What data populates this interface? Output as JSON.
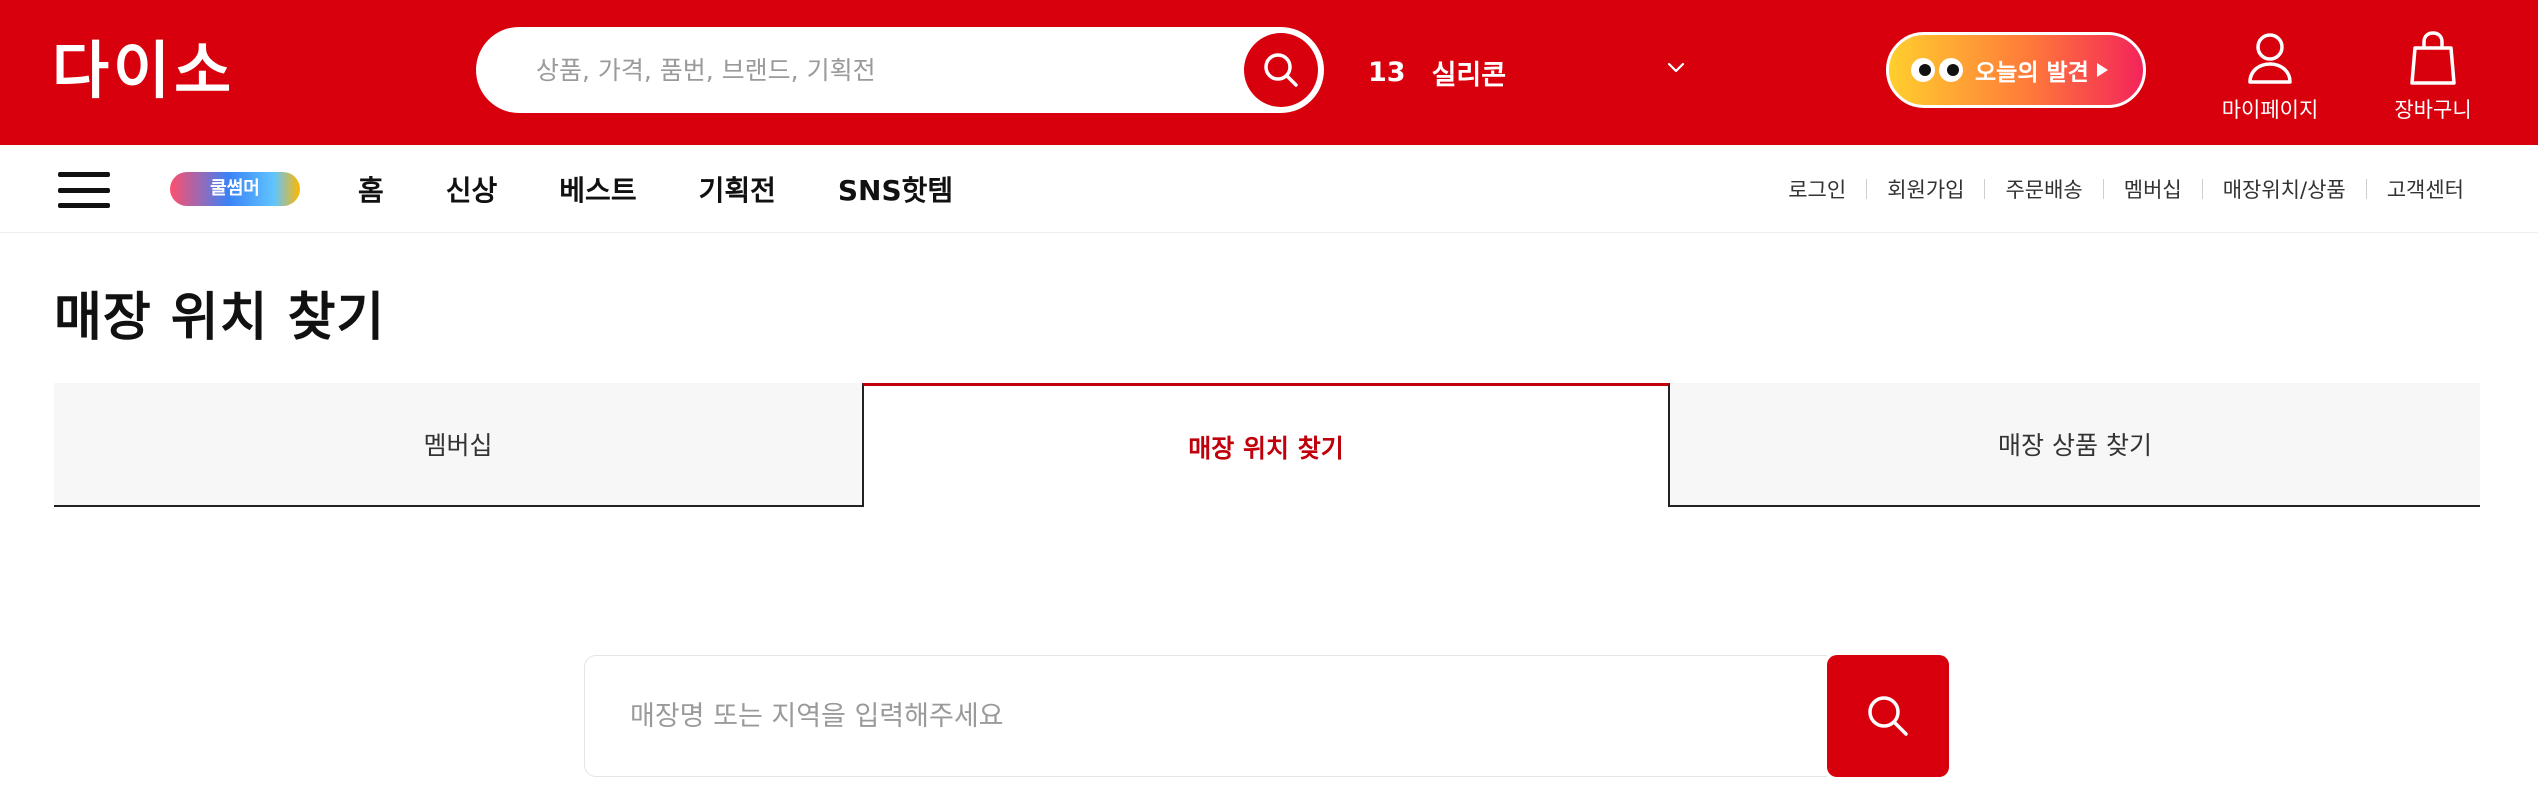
{
  "header": {
    "logo_text": "다이소",
    "search_placeholder": "상품, 가격, 품번, 브랜드, 기획전",
    "ranking": {
      "number": "13",
      "keyword": "실리콘"
    },
    "discover_label": "오늘의 발견",
    "mypage_label": "마이페이지",
    "cart_label": "장바구니"
  },
  "nav": {
    "promo_label": "쿨썸머",
    "menu": [
      "홈",
      "신상",
      "베스트",
      "기획전",
      "SNS핫템"
    ],
    "util_links": [
      "로그인",
      "회원가입",
      "주문배송",
      "멤버십",
      "매장위치/상품",
      "고객센터"
    ]
  },
  "page": {
    "title": "매장 위치 찾기",
    "tabs": [
      "멤버십",
      "매장 위치 찾기",
      "매장 상품 찾기"
    ],
    "active_tab": 1,
    "store_search_placeholder": "매장명 또는 지역을 입력해주세요"
  },
  "colors": {
    "brand_red": "#d8000c",
    "active_tab_text": "#c0000b",
    "tab_inactive_bg": "#f7f7f7"
  },
  "icons": {
    "search": "search-icon",
    "chevron": "chevron-down-icon",
    "user": "user-icon",
    "cart": "shopping-bag-icon",
    "menu": "hamburger-menu-icon"
  }
}
